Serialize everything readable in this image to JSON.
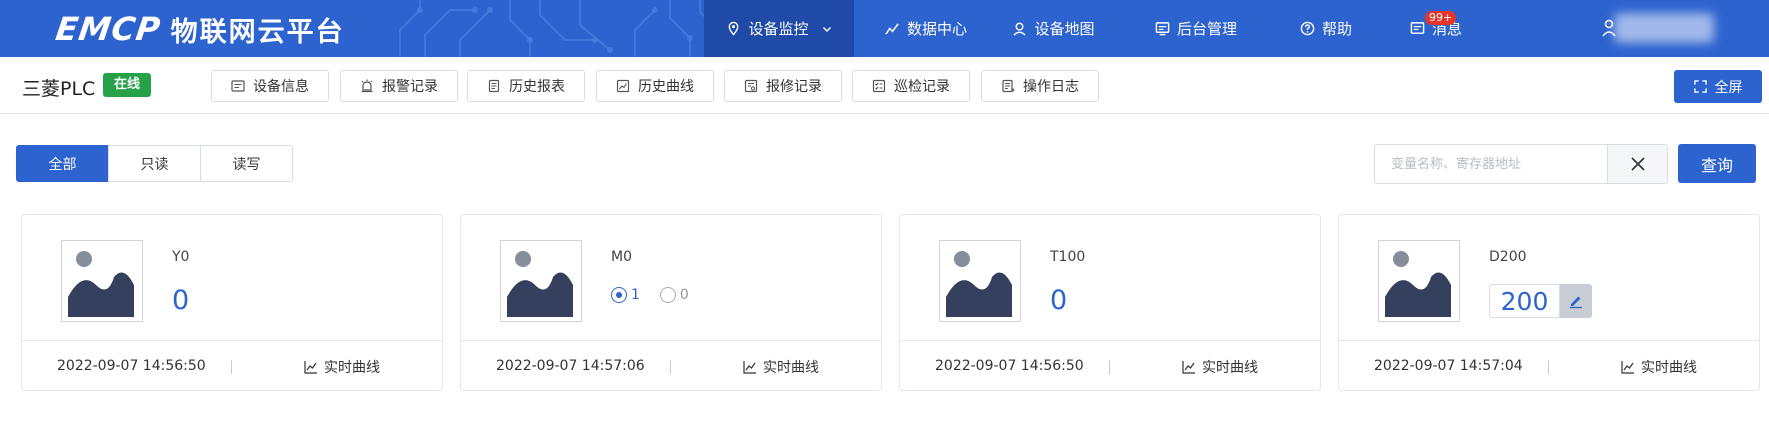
{
  "brand": {
    "logo": "EMCP",
    "subtitle": "物联网云平台"
  },
  "nav": {
    "items": [
      {
        "label": "设备监控",
        "icon": "location-pin-icon",
        "active": true
      },
      {
        "label": "数据中心",
        "icon": "chart-line-icon"
      },
      {
        "label": "设备地图",
        "icon": "map-user-icon"
      },
      {
        "label": "后台管理",
        "icon": "monitor-icon"
      },
      {
        "label": "帮助",
        "icon": "help-circle-icon"
      },
      {
        "label": "消息",
        "icon": "message-icon",
        "badge": "99+"
      }
    ]
  },
  "device": {
    "name": "三菱PLC",
    "status": "在线"
  },
  "subtabs": [
    {
      "label": "设备信息",
      "icon": "device-info-icon"
    },
    {
      "label": "报警记录",
      "icon": "alarm-icon"
    },
    {
      "label": "历史报表",
      "icon": "report-icon"
    },
    {
      "label": "历史曲线",
      "icon": "history-curve-icon"
    },
    {
      "label": "报修记录",
      "icon": "repair-icon"
    },
    {
      "label": "巡检记录",
      "icon": "inspection-icon"
    },
    {
      "label": "操作日志",
      "icon": "log-icon"
    }
  ],
  "fullscreen_label": "全屏",
  "filter": {
    "segments": [
      "全部",
      "只读",
      "读写"
    ],
    "active_segment": "全部",
    "search_placeholder": "变量名称、寄存器地址",
    "search_value": "",
    "query_label": "查询"
  },
  "cards": [
    {
      "name": "Y0",
      "value": "0",
      "kind": "readonly",
      "timestamp": "2022-09-07 14:56:50",
      "curve_label": "实时曲线"
    },
    {
      "name": "M0",
      "kind": "radio",
      "options": [
        "1",
        "0"
      ],
      "selected": "1",
      "timestamp": "2022-09-07 14:57:06",
      "curve_label": "实时曲线"
    },
    {
      "name": "T100",
      "value": "0",
      "kind": "readonly",
      "timestamp": "2022-09-07 14:56:50",
      "curve_label": "实时曲线"
    },
    {
      "name": "D200",
      "value": "200",
      "kind": "editable",
      "timestamp": "2022-09-07 14:57:04",
      "curve_label": "实时曲线"
    }
  ],
  "colors": {
    "primary": "#2d63cf",
    "online": "#27a148",
    "badge": "#e5352b"
  }
}
